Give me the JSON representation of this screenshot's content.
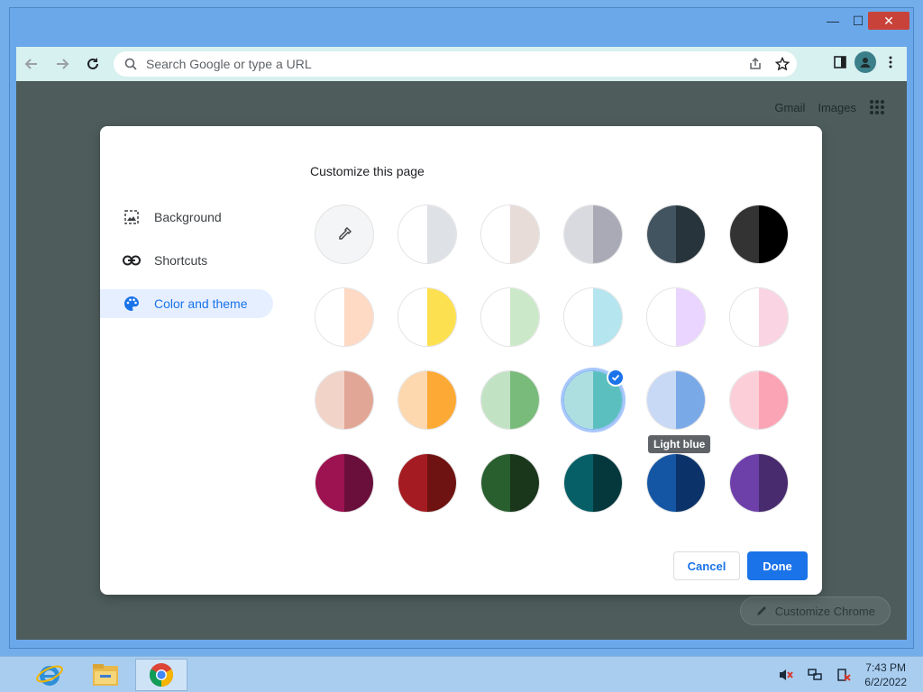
{
  "window": {
    "minimize_glyph": "—",
    "maximize_glyph": "☐",
    "close_glyph": "✕"
  },
  "toolbar": {
    "omnibox_placeholder": "Search Google or type a URL",
    "icons": [
      "back-icon",
      "forward-icon",
      "reload-icon",
      "search-icon",
      "share-icon",
      "bookmark-star-icon",
      "side-panel-icon",
      "profile-icon",
      "menu-icon"
    ]
  },
  "page": {
    "links": {
      "gmail": "Gmail",
      "images": "Images"
    },
    "customize_chrome_label": "Customize Chrome"
  },
  "dialog": {
    "title": "Customize this page",
    "sidebar": [
      {
        "label": "Background",
        "icon": "image-icon",
        "active": false
      },
      {
        "label": "Shortcuts",
        "icon": "link-icon",
        "active": false
      },
      {
        "label": "Color and theme",
        "icon": "palette-icon",
        "active": true
      }
    ],
    "swatches": [
      [
        {
          "name": "custom-color",
          "left": "#f4f5f6",
          "right": "#f4f5f6",
          "picker": true
        },
        {
          "name": "default",
          "left": "#ffffff",
          "right": "#dee1e6"
        },
        {
          "name": "warm-grey",
          "left": "#ffffff",
          "right": "#e8dcd8"
        },
        {
          "name": "cool-grey",
          "left": "#d9dadf",
          "right": "#a9aab6"
        },
        {
          "name": "midnight-blue",
          "left": "#435461",
          "right": "#28343b"
        },
        {
          "name": "black",
          "left": "#333333",
          "right": "#000000"
        }
      ],
      [
        {
          "name": "beige-and-white",
          "left": "#ffffff",
          "right": "#fed9c4"
        },
        {
          "name": "yellow-and-white",
          "left": "#ffffff",
          "right": "#fde04f"
        },
        {
          "name": "green-and-white",
          "left": "#ffffff",
          "right": "#cbe9c8"
        },
        {
          "name": "light-teal-and-white",
          "left": "#ffffff",
          "right": "#b5e5ef"
        },
        {
          "name": "light-purple-and-white",
          "left": "#ffffff",
          "right": "#e9d5ff"
        },
        {
          "name": "pink-and-white",
          "left": "#ffffff",
          "right": "#fad4e2"
        }
      ],
      [
        {
          "name": "beige",
          "left": "#f2d3c8",
          "right": "#e2a696"
        },
        {
          "name": "orange",
          "left": "#fdd7ae",
          "right": "#fda935"
        },
        {
          "name": "light-green",
          "left": "#c2e2c4",
          "right": "#78bb7b"
        },
        {
          "name": "light-teal",
          "left": "#aedfe0",
          "right": "#5bbfbf",
          "selected": true
        },
        {
          "name": "light-blue",
          "left": "#c8d9f6",
          "right": "#7aa9e8",
          "tooltip": "Light blue"
        },
        {
          "name": "light-pink",
          "left": "#fccfd8",
          "right": "#fba4b6"
        }
      ],
      [
        {
          "name": "dark-pink-and-red",
          "left": "#9d1251",
          "right": "#6a0f3b"
        },
        {
          "name": "dark-red-and-orange",
          "left": "#a51b22",
          "right": "#6e1311"
        },
        {
          "name": "dark-green",
          "left": "#295f2e",
          "right": "#1a371b"
        },
        {
          "name": "dark-teal",
          "left": "#065f66",
          "right": "#05383c"
        },
        {
          "name": "dark-blue",
          "left": "#1556a4",
          "right": "#0c3369"
        },
        {
          "name": "purple",
          "left": "#6d3fa9",
          "right": "#482a6f"
        }
      ]
    ],
    "cancel_label": "Cancel",
    "done_label": "Done"
  },
  "taskbar": {
    "apps": [
      "internet-explorer",
      "file-explorer",
      "chrome"
    ],
    "time": "7:43 PM",
    "date": "6/2/2022"
  },
  "colors": {
    "accent": "#1a73e8",
    "toolbar_bg": "#d7f0f0",
    "page_bg": "#4e5d5c"
  }
}
